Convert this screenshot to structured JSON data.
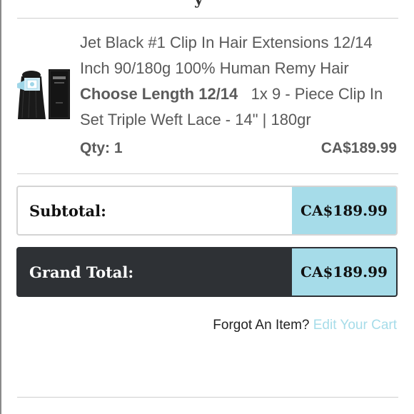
{
  "header": {
    "partial_title": "y"
  },
  "cart_item": {
    "name": "Jet Black #1 Clip In Hair Extensions 12/14 Inch 90/180g 100% Human Remy Hair",
    "option_label": "Choose Length 12/14",
    "option_value": "1x 9 - Piece Clip In Set Triple Weft Lace - 14\" | 180gr",
    "qty_text": "Qty: 1",
    "price": "CA$189.99",
    "thumbnail_icon": "hair-extension-product-icon"
  },
  "totals": {
    "subtotal_label": "Subtotal:",
    "subtotal_value": "CA$189.99",
    "grand_total_label": "Grand Total:",
    "grand_total_value": "CA$189.99"
  },
  "footer_prompt": {
    "text": "Forgot An Item?",
    "link_text": "Edit Your Cart"
  },
  "colors": {
    "accent": "#a6dce9",
    "dark": "#2e3135",
    "text": "#5b5b5b"
  }
}
